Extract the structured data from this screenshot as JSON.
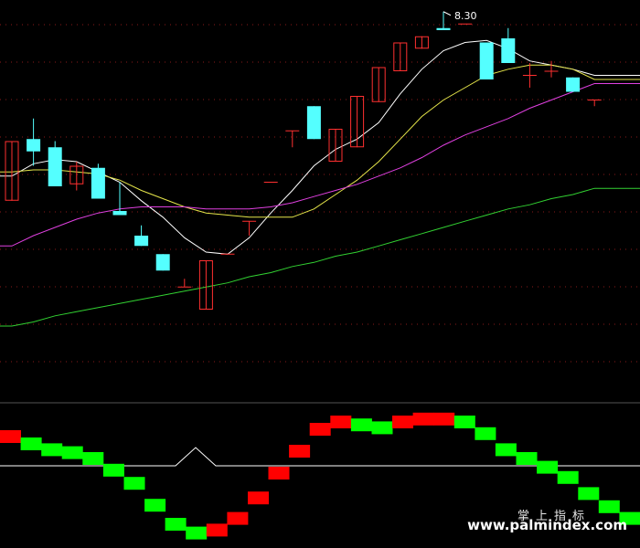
{
  "chart_data": [
    {
      "type": "candlestick",
      "peak_label": "8.30",
      "y_range": [
        6.45,
        8.33
      ],
      "candles": [
        {
          "o": 7.38,
          "c": 7.67,
          "h": 7.67,
          "l": 7.38
        },
        {
          "o": 7.68,
          "c": 7.62,
          "h": 7.78,
          "l": 7.55
        },
        {
          "o": 7.64,
          "c": 7.45,
          "h": 7.67,
          "l": 7.45
        },
        {
          "o": 7.46,
          "c": 7.55,
          "h": 7.57,
          "l": 7.43
        },
        {
          "o": 7.54,
          "c": 7.39,
          "h": 7.56,
          "l": 7.39
        },
        {
          "o": 7.33,
          "c": 7.31,
          "h": 7.47,
          "l": 7.31
        },
        {
          "o": 7.21,
          "c": 7.16,
          "h": 7.26,
          "l": 7.16
        },
        {
          "o": 7.12,
          "c": 7.04,
          "h": 7.12,
          "l": 7.04
        },
        {
          "o": 6.96,
          "c": 6.96,
          "h": 7.0,
          "l": 6.96
        },
        {
          "o": 6.85,
          "c": 7.09,
          "h": 7.09,
          "l": 6.85
        },
        {
          "o": 7.12,
          "c": 7.12,
          "h": 7.12,
          "l": 7.12
        },
        {
          "o": 7.28,
          "c": 7.28,
          "h": 7.28,
          "l": 7.21
        },
        {
          "o": 7.47,
          "c": 7.47,
          "h": 7.47,
          "l": 7.47
        },
        {
          "o": 7.72,
          "c": 7.72,
          "h": 7.72,
          "l": 7.64
        },
        {
          "o": 7.84,
          "c": 7.68,
          "h": 7.84,
          "l": 7.68
        },
        {
          "o": 7.57,
          "c": 7.73,
          "h": 7.73,
          "l": 7.57
        },
        {
          "o": 7.64,
          "c": 7.89,
          "h": 7.89,
          "l": 7.64
        },
        {
          "o": 7.86,
          "c": 8.03,
          "h": 8.03,
          "l": 7.86
        },
        {
          "o": 8.01,
          "c": 8.15,
          "h": 8.15,
          "l": 8.01
        },
        {
          "o": 8.12,
          "c": 8.18,
          "h": 8.18,
          "l": 8.12
        },
        {
          "o": 8.22,
          "c": 8.21,
          "h": 8.3,
          "l": 8.21
        },
        {
          "o": 8.24,
          "c": 8.24,
          "h": 8.24,
          "l": 8.24
        },
        {
          "o": 8.15,
          "c": 7.97,
          "h": 8.15,
          "l": 7.97
        },
        {
          "o": 8.17,
          "c": 8.05,
          "h": 8.22,
          "l": 8.05
        },
        {
          "o": 7.99,
          "c": 7.99,
          "h": 8.05,
          "l": 7.93
        },
        {
          "o": 8.01,
          "c": 8.01,
          "h": 8.06,
          "l": 7.98
        },
        {
          "o": 7.98,
          "c": 7.91,
          "h": 7.98,
          "l": 7.91
        },
        {
          "o": 7.87,
          "c": 7.87,
          "h": 7.87,
          "l": 7.84
        }
      ],
      "moving_averages": [
        {
          "color": "#ffffff",
          "values": [
            7.5,
            7.56,
            7.58,
            7.57,
            7.52,
            7.47,
            7.38,
            7.3,
            7.2,
            7.13,
            7.12,
            7.2,
            7.32,
            7.43,
            7.55,
            7.63,
            7.68,
            7.76,
            7.9,
            8.02,
            8.11,
            8.15,
            8.16,
            8.12,
            8.06,
            8.04,
            8.02,
            7.99
          ]
        },
        {
          "color": "#e6e64a",
          "values": [
            7.52,
            7.53,
            7.53,
            7.52,
            7.51,
            7.48,
            7.43,
            7.39,
            7.35,
            7.32,
            7.31,
            7.3,
            7.3,
            7.3,
            7.34,
            7.41,
            7.48,
            7.57,
            7.68,
            7.79,
            7.87,
            7.93,
            7.99,
            8.02,
            8.04,
            8.04,
            8.02,
            7.97
          ]
        },
        {
          "color": "#e040e0",
          "values": [
            7.16,
            7.21,
            7.25,
            7.29,
            7.32,
            7.34,
            7.35,
            7.35,
            7.35,
            7.34,
            7.34,
            7.34,
            7.35,
            7.37,
            7.4,
            7.43,
            7.46,
            7.5,
            7.54,
            7.59,
            7.65,
            7.7,
            7.74,
            7.78,
            7.83,
            7.87,
            7.91,
            7.95
          ]
        },
        {
          "color": "#32d232",
          "values": [
            6.77,
            6.79,
            6.82,
            6.84,
            6.86,
            6.88,
            6.9,
            6.92,
            6.94,
            6.96,
            6.98,
            7.01,
            7.03,
            7.06,
            7.08,
            7.11,
            7.13,
            7.16,
            7.19,
            7.22,
            7.25,
            7.28,
            7.31,
            7.34,
            7.36,
            7.39,
            7.41,
            7.44
          ]
        }
      ]
    },
    {
      "type": "step-oscillator",
      "y_range": [
        -5.5,
        3.5
      ],
      "baseline": 0,
      "values": [
        2.0,
        1.5,
        1.1,
        0.9,
        0.5,
        -0.3,
        -1.2,
        -2.7,
        -4.0,
        -4.6,
        -4.4,
        -3.6,
        -2.2,
        -0.5,
        1.0,
        2.5,
        3.0,
        2.8,
        2.6,
        3.0,
        3.2,
        3.2,
        3.0,
        2.2,
        1.1,
        0.5,
        -0.1,
        -0.8,
        -1.9,
        -2.8,
        -3.6
      ]
    }
  ],
  "watermark": {
    "cn": "掌上指标",
    "url": "www.palmindex.com"
  },
  "colors": {
    "background": "#000000",
    "up": "#ff3030",
    "down": "#54ffff",
    "osc_up": "#ff0000",
    "osc_down": "#00ff00",
    "separator": "#555555",
    "grid": "#8a1a1a"
  }
}
